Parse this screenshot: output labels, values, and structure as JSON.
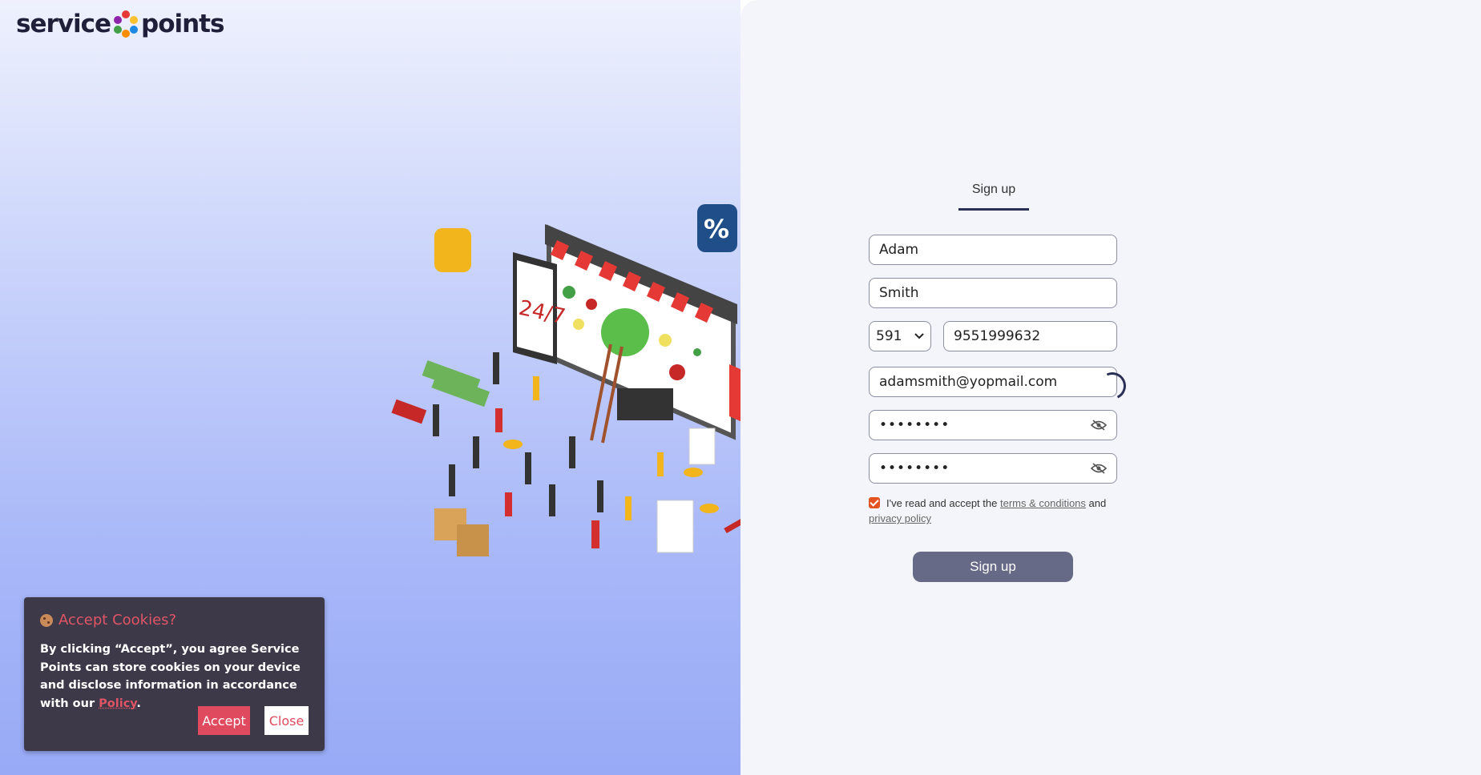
{
  "brand": {
    "logo_text_left": "service",
    "logo_text_right": "points"
  },
  "form": {
    "tab_label": "Sign up",
    "first_name": "Adam",
    "last_name": "Smith",
    "country_code": "591",
    "phone": "9551999632",
    "email": "adamsmith@yopmail.com",
    "password_mask": "••••••••",
    "confirm_password_mask": "••••••••",
    "terms_prefix": "I've read and accept the",
    "terms_link": "terms & conditions",
    "terms_and": "and",
    "privacy_link": "privacy policy",
    "submit_label": "Sign up",
    "terms_checked": true
  },
  "cookie_banner": {
    "title": "Accept Cookies?",
    "body_text": "By clicking “Accept”, you agree Service Points can store cookies on your device and disclose information in accordance with our",
    "policy_link": "Policy",
    "period": ".",
    "accept_label": "Accept",
    "close_label": "Close"
  },
  "colors": {
    "accent": "#e3531f",
    "primary_dark": "#2a2f56",
    "button": "#666a87",
    "cookie_bg": "#3d3949",
    "cookie_accent": "#e04a5e"
  }
}
